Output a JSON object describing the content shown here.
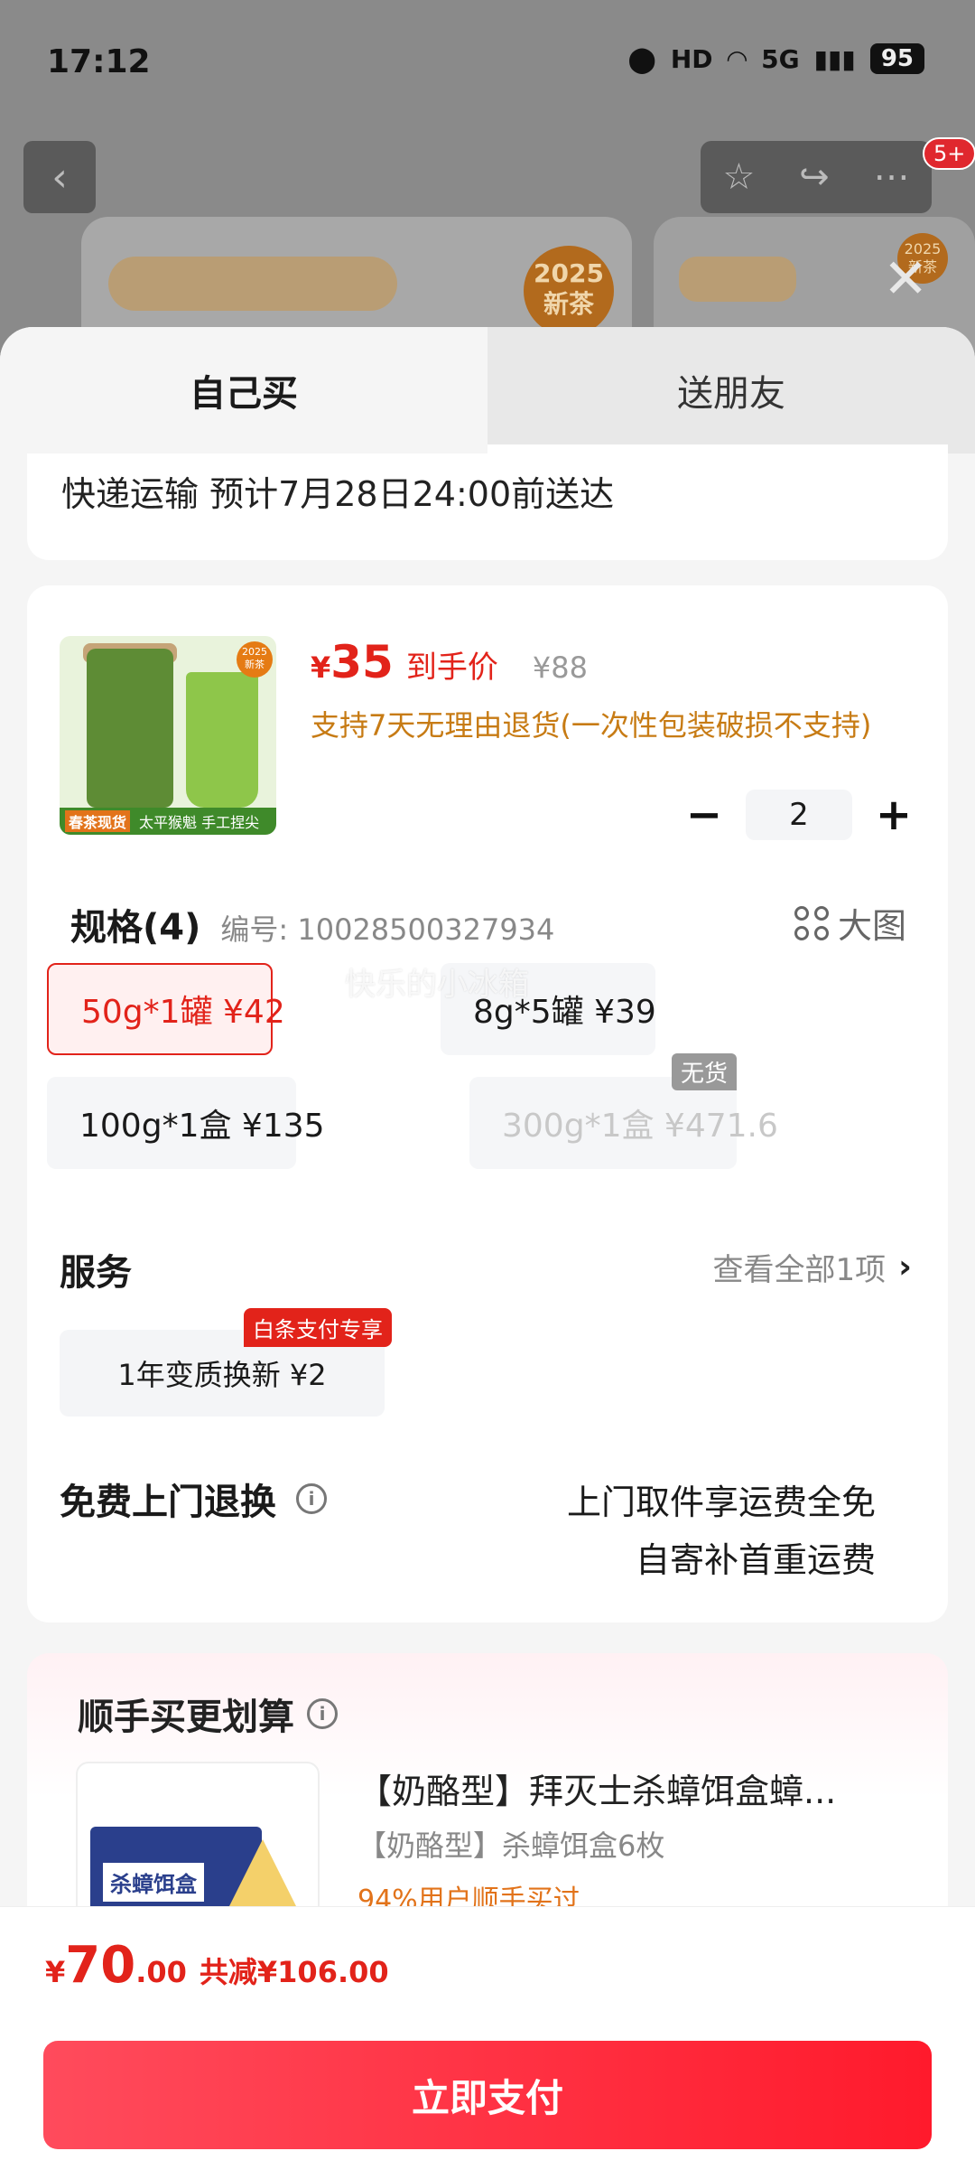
{
  "status": {
    "time": "17:12",
    "battery": "95",
    "network": "5G"
  },
  "background": {
    "cart_badge": "5+",
    "new_tag": "2025 新茶",
    "new_tag_small": "2025 新茶"
  },
  "tabs": {
    "self": "自己买",
    "gift": "送朋友"
  },
  "delivery": {
    "text": "快递运输 预计7月28日24:00前送达"
  },
  "product": {
    "price_currency": "¥",
    "price_now": "35",
    "price_label": "到手价",
    "price_orig": "¥88",
    "return_note": "支持7天无理由退货(一次性包装破损不支持)",
    "qty": "2",
    "img_tag": "2025 新茶",
    "img_band_a": "春茶现货",
    "img_band_b": "太平猴魁 手工捏尖"
  },
  "spec": {
    "title": "规格(4)",
    "code": "编号: 10028500327934",
    "big_img": "大图",
    "options": [
      {
        "label": "50g*1罐 ¥42",
        "selected": true,
        "available": true
      },
      {
        "label": "8g*5罐 ¥39",
        "selected": false,
        "available": true
      },
      {
        "label": "100g*1盒 ¥135",
        "selected": false,
        "available": true
      },
      {
        "label": "300g*1盒 ¥471.6",
        "selected": false,
        "available": false
      }
    ],
    "out_of_stock": "无货",
    "watermark": "快乐的小冰箱"
  },
  "service": {
    "title": "服务",
    "view_all": "查看全部1项",
    "chip": "1年变质换新 ¥2",
    "chip_badge": "白条支付专享"
  },
  "free_return": {
    "title": "免费上门退换",
    "line1": "上门取件享运费全免",
    "line2": "自寄补首重运费"
  },
  "addon": {
    "title": "顺手买更划算",
    "name": "【奶酪型】拜灭士杀蟑饵盒蟑...",
    "sub": "【奶酪型】杀蟑饵盒6枚",
    "more": "94%用户顺手买过",
    "box_label": "杀蟑饵盒"
  },
  "footer": {
    "currency": "¥",
    "total_int": "70",
    "total_dec": ".00",
    "saving": "共减¥106.00",
    "pay": "立即支付"
  },
  "colors": {
    "accent": "#e2231a",
    "pay_gradient_start": "#ff4b5c",
    "pay_gradient_end": "#ff1a2c",
    "note": "#c77b14"
  }
}
